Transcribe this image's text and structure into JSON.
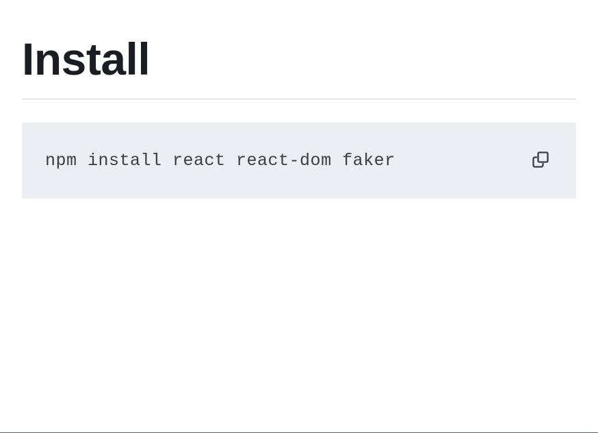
{
  "header": {
    "title": "Install"
  },
  "code_block": {
    "command": "npm install react react-dom faker"
  }
}
